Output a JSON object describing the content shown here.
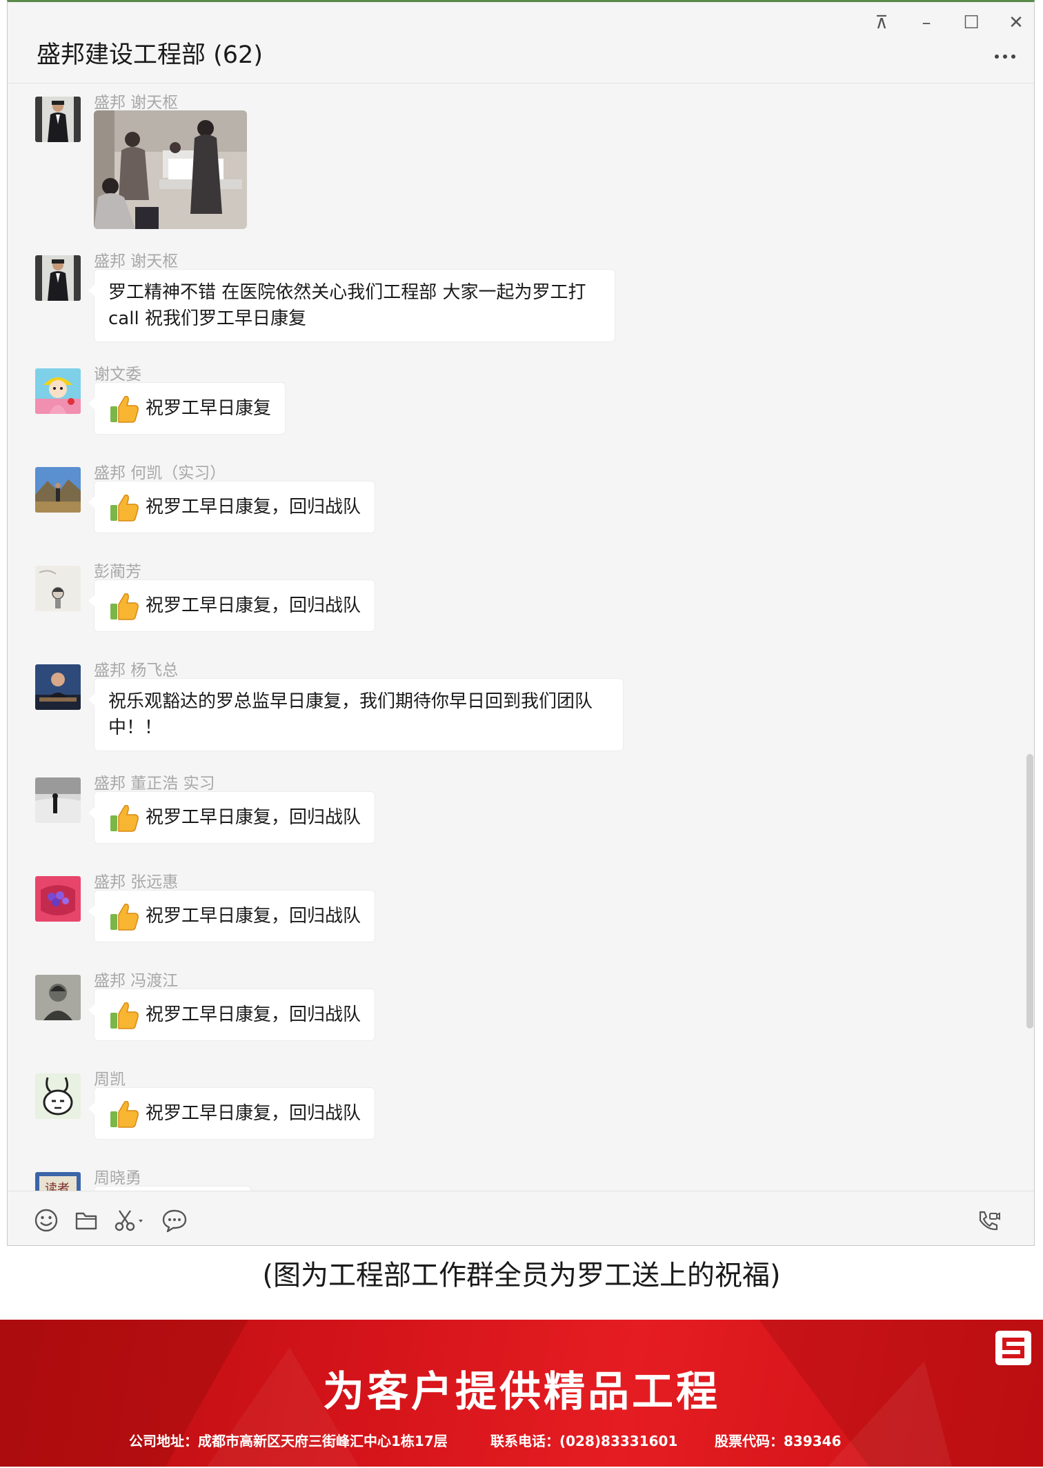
{
  "window": {
    "title": "盛邦建设工程部 (62)",
    "controls": {
      "pin": "⊼",
      "minimize": "–",
      "maximize": "☐",
      "close": "✕"
    },
    "more_icon": "more-dots-icon"
  },
  "messages": [
    {
      "sender": "盛邦 谢天枢",
      "type": "image",
      "avatar_icon": "avatar-man-suit"
    },
    {
      "sender": "盛邦 谢天枢",
      "type": "text",
      "text": "罗工精神不错 在医院依然关心我们工程部 大家一起为罗工打call 祝我们罗工早日康复",
      "avatar_icon": "avatar-man-suit"
    },
    {
      "sender": "谢文委",
      "type": "text",
      "text": "祝罗工早日康复",
      "thumbs_up": true,
      "avatar_icon": "avatar-cartoon-girl"
    },
    {
      "sender": "盛邦 何凯（实习）",
      "type": "text",
      "text": "祝罗工早日康复，回归战队",
      "thumbs_up": true,
      "avatar_icon": "avatar-landscape"
    },
    {
      "sender": "彭蔺芳",
      "type": "text",
      "text": "祝罗工早日康复，回归战队",
      "thumbs_up": true,
      "avatar_icon": "avatar-sketch"
    },
    {
      "sender": "盛邦 杨飞总",
      "type": "text",
      "text": "祝乐观豁达的罗总监早日康复，我们期待你早日回到我们团队中！！",
      "avatar_icon": "avatar-man-desk"
    },
    {
      "sender": "盛邦 董正浩 实习",
      "type": "text",
      "text": "祝罗工早日康复，回归战队",
      "thumbs_up": true,
      "avatar_icon": "avatar-bw-photo"
    },
    {
      "sender": "盛邦 张远惠",
      "type": "text",
      "text": "祝罗工早日康复，回归战队",
      "thumbs_up": true,
      "avatar_icon": "avatar-flowers"
    },
    {
      "sender": "盛邦 冯渡江",
      "type": "text",
      "text": "祝罗工早日康复，回归战队",
      "thumbs_up": true,
      "avatar_icon": "avatar-portrait-bw"
    },
    {
      "sender": "周凯",
      "type": "text",
      "text": "祝罗工早日康复，回归战队",
      "thumbs_up": true,
      "avatar_icon": "avatar-bunny"
    },
    {
      "sender": "周晓勇",
      "type": "text",
      "text": "",
      "avatar_icon": "avatar-calligraphy"
    }
  ],
  "toolbar": {
    "emoji": "emoji-icon",
    "file": "folder-icon",
    "screenshot": "scissors-icon",
    "chat_history": "chat-bubble-icon",
    "call": "phone-video-icon"
  },
  "caption": "(图为工程部工作群全员为罗工送上的祝福)",
  "banner": {
    "slogan": "为客户提供精品工程",
    "address": "公司地址：成都市高新区天府三街峰汇中心1栋17层",
    "phone": "联系电话：(028)83331601",
    "stock": "股票代码：839346",
    "colors": {
      "primary": "#d4141a",
      "dark": "#b80d10"
    }
  }
}
